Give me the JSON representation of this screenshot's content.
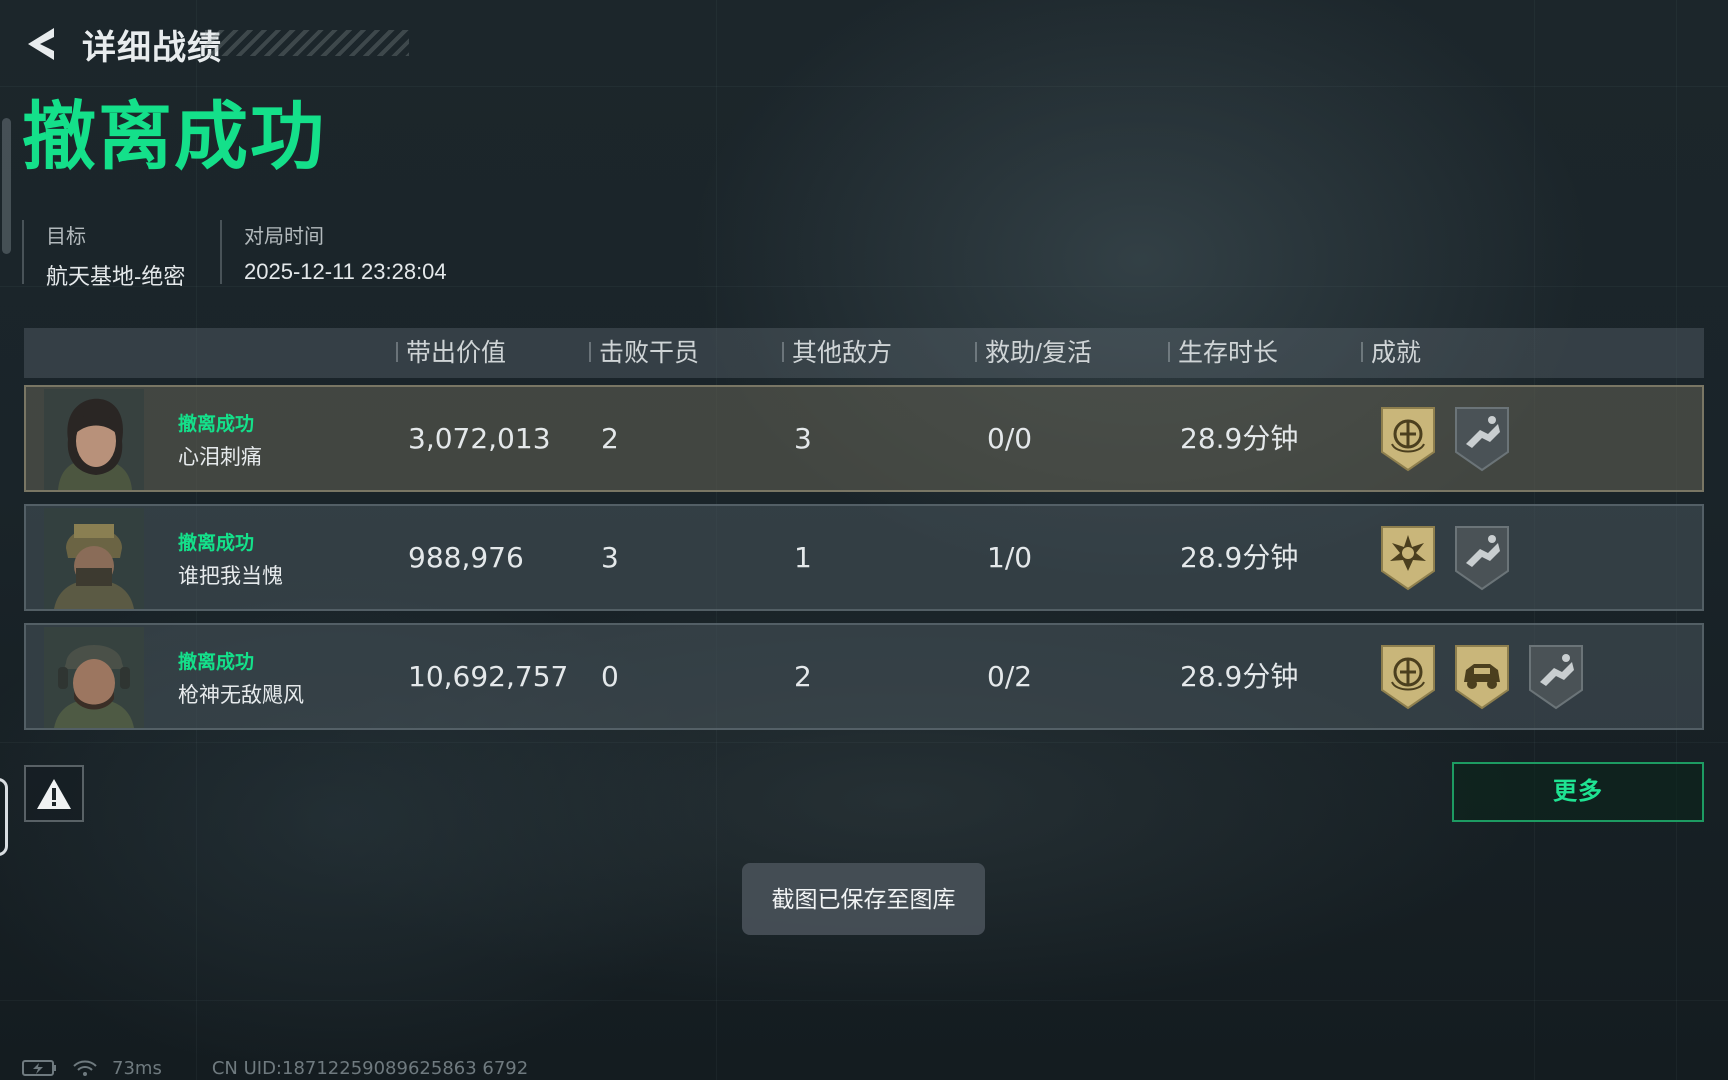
{
  "header": {
    "title": "详细战绩"
  },
  "result": {
    "title": "撤离成功",
    "target_label": "目标",
    "target_value": "航天基地-绝密",
    "time_label": "对局时间",
    "time_value": "2025-12-11 23:28:04"
  },
  "table": {
    "columns": [
      "带出价值",
      "击败干员",
      "其他敌方",
      "救助/复活",
      "生存时长",
      "成就"
    ],
    "rows": [
      {
        "status": "撤离成功",
        "name": "心泪刺痛",
        "value": "3,072,013",
        "kills": "2",
        "other_enemies": "3",
        "assist_revive": "0/0",
        "survival": "28.9分钟",
        "badges": [
          "gold-emblem-badge-icon",
          "grey-runner-badge-icon"
        ],
        "highlighted": true
      },
      {
        "status": "撤离成功",
        "name": "谁把我当愧",
        "value": "988,976",
        "kills": "3",
        "other_enemies": "1",
        "assist_revive": "1/0",
        "survival": "28.9分钟",
        "badges": [
          "gold-star-badge-icon",
          "grey-runner-badge-icon"
        ],
        "highlighted": false
      },
      {
        "status": "撤离成功",
        "name": "枪神无敌飓风",
        "value": "10,692,757",
        "kills": "0",
        "other_enemies": "2",
        "assist_revive": "0/2",
        "survival": "28.9分钟",
        "badges": [
          "gold-emblem-badge-icon",
          "gold-vehicle-badge-icon",
          "grey-runner-badge-icon"
        ],
        "highlighted": false
      }
    ]
  },
  "actions": {
    "more_label": "更多"
  },
  "toast": {
    "text": "截图已保存至图库"
  },
  "status_bar": {
    "ping": "73ms",
    "uid": "CN UID:18712259089625863 6792"
  },
  "colors": {
    "accent": "#14e08a",
    "badge_gold": "#c9b67a",
    "badge_grey": "#4a5256"
  }
}
